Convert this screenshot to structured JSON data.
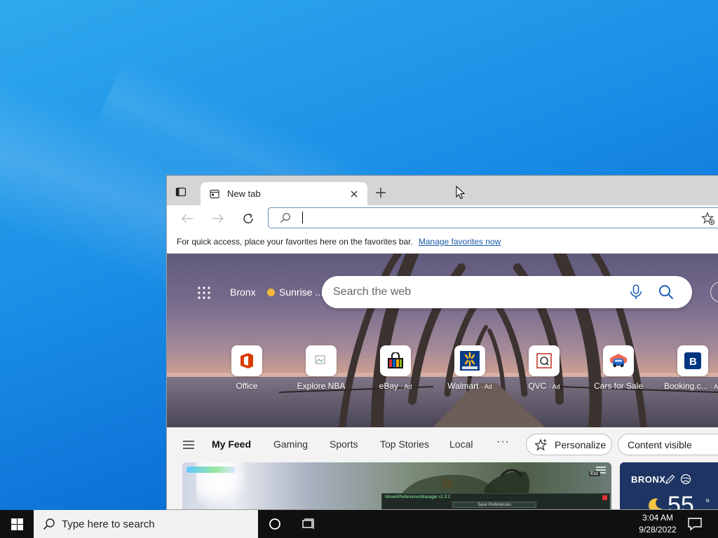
{
  "browser": {
    "tab": {
      "title": "New tab"
    },
    "address": {
      "value": ""
    },
    "favorites_bar": {
      "message": "For quick access, place your favorites here on the favorites bar.",
      "link": "Manage favorites now"
    }
  },
  "hero": {
    "location": "Bronx",
    "weather_note": "Sunrise ...",
    "search_placeholder": "Search the web",
    "quick_links": [
      {
        "label": "Office",
        "ad": "",
        "icon": "office-logo"
      },
      {
        "label": "Explore NBA",
        "ad": "",
        "icon": "broken-image"
      },
      {
        "label": "eBay",
        "ad": "· Ad",
        "icon": "shopping-bag"
      },
      {
        "label": "Walmart",
        "ad": "· Ad",
        "icon": "walmart-spark"
      },
      {
        "label": "QVC",
        "ad": "· Ad",
        "icon": "qvc-logo"
      },
      {
        "label": "Cars for Sale",
        "ad": "",
        "icon": "car"
      },
      {
        "label": "Booking.c...",
        "ad": "· Ad",
        "icon": "booking-b"
      }
    ]
  },
  "feed_nav": {
    "items": [
      "My Feed",
      "Gaming",
      "Sports",
      "Top Stories",
      "Local"
    ],
    "more": "···",
    "personalize": "Personalize",
    "content_visible": "Content visible"
  },
  "feed": {
    "card_panel_title": "MoveHPreferencesManager v1.3.2",
    "card_panel_button": "Save Preferences",
    "card_badge": "Esc",
    "weather": {
      "city": "BRONX",
      "temp": "55",
      "unit": "°"
    }
  },
  "taskbar": {
    "search_placeholder": "Type here to search",
    "time": "3:04 AM",
    "date": "9/28/2022"
  },
  "colors": {
    "desktop": "#1a8fe6",
    "accent_link": "#1a5aa8",
    "weather_card": "#1e3563",
    "taskbar": "#101010"
  }
}
